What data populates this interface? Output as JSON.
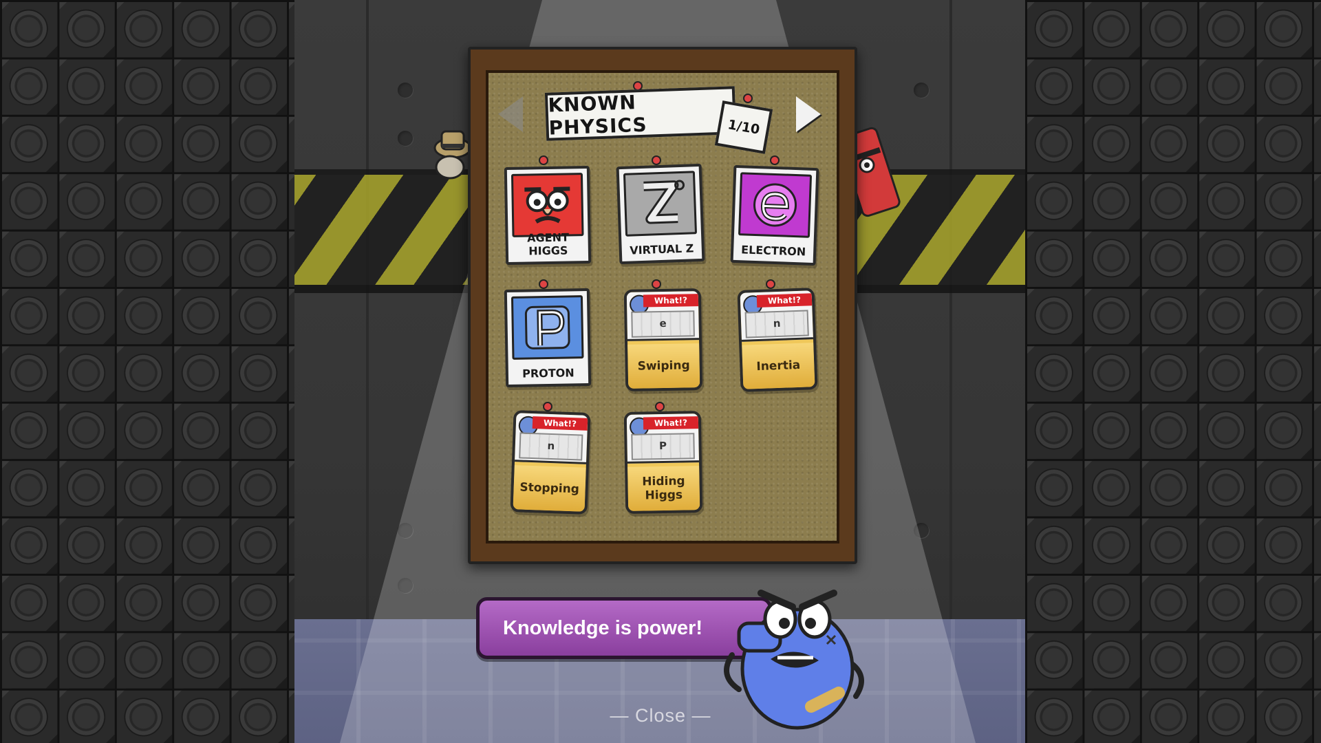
{
  "board": {
    "title": "KNOWN PHYSICS",
    "page_indicator": "1/10"
  },
  "cards": [
    {
      "label": "AGENT HIGGS",
      "type": "character",
      "color": "#e53935"
    },
    {
      "label": "VIRTUAL Z",
      "type": "character",
      "color": "#9e9e9e"
    },
    {
      "label": "ELECTRON",
      "type": "character",
      "color": "#c03ad0"
    },
    {
      "label": "PROTON",
      "type": "character",
      "color": "#5b8fe0"
    }
  ],
  "what_cards": [
    {
      "tag": "What!?",
      "label": "Swiping"
    },
    {
      "tag": "What!?",
      "label": "Inertia"
    },
    {
      "tag": "What!?",
      "label": "Stopping"
    },
    {
      "tag": "What!?",
      "label": "Hiding Higgs"
    }
  ],
  "dialog": {
    "text": "Knowledge is power!"
  },
  "close_label": "— Close —"
}
